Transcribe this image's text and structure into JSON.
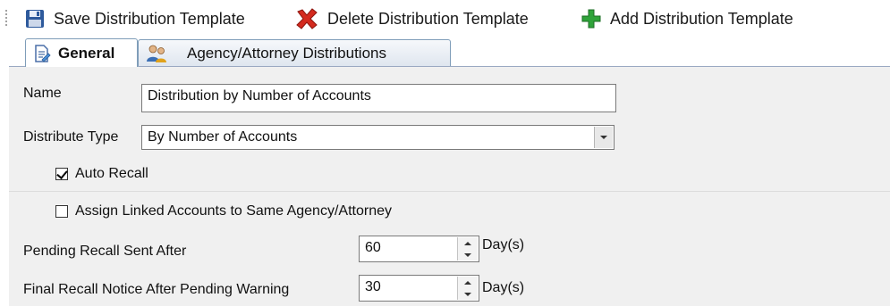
{
  "toolbar": {
    "save_label": "Save Distribution Template",
    "delete_label": "Delete Distribution Template",
    "add_label": "Add Distribution Template"
  },
  "tabs": [
    {
      "label": "General",
      "active": true
    },
    {
      "label": "Agency/Attorney Distributions",
      "active": false
    }
  ],
  "form": {
    "name_label": "Name",
    "name_value": "Distribution by Number of Accounts",
    "distribute_type_label": "Distribute Type",
    "distribute_type_value": "By Number of Accounts",
    "auto_recall_label": "Auto Recall",
    "auto_recall_checked": true,
    "assign_linked_label": "Assign Linked Accounts to Same Agency/Attorney",
    "assign_linked_checked": false,
    "pending_recall_label": "Pending Recall Sent After",
    "pending_recall_value": "60",
    "pending_recall_unit": "Day(s)",
    "final_recall_label": "Final Recall Notice After Pending Warning",
    "final_recall_value": "30",
    "final_recall_unit": "Day(s)"
  },
  "icons": {
    "save": "floppy-disk-icon",
    "delete": "red-x-icon",
    "add": "green-plus-icon",
    "general_tab": "document-edit-icon",
    "agency_tab": "people-icon"
  },
  "colors": {
    "accent": "#2e5a9c",
    "delete_red": "#d42a1e",
    "add_green": "#2fa33a",
    "panel_bg": "#f0f0f0"
  }
}
